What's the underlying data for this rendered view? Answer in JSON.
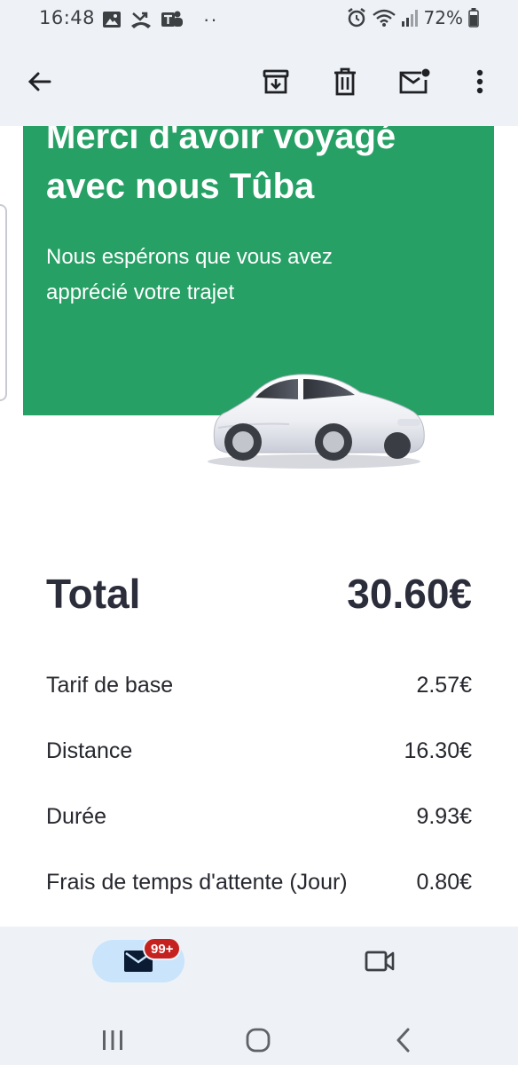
{
  "status_bar": {
    "time": "16:48",
    "dots": "··",
    "battery_percent": "72%",
    "icons": [
      "gallery-icon",
      "missed-call-icon",
      "teams-icon",
      "alarm-icon",
      "wifi-icon",
      "signal-icon",
      "battery-icon"
    ]
  },
  "toolbar": {
    "icons": [
      "back-arrow-icon",
      "archive-icon",
      "delete-icon",
      "mark-unread-icon",
      "more-vert-icon"
    ]
  },
  "email": {
    "hero_title_line1": "Merci d'avoir voyagé",
    "hero_title_line2": "avec nous Tûba",
    "hero_subtitle_line1": "Nous espérons que vous avez",
    "hero_subtitle_line2": "apprécié votre trajet",
    "hero_color": "#26a065",
    "total_label": "Total",
    "total_value": "30.60€",
    "items": [
      {
        "label": "Tarif de base",
        "value": "2.57€"
      },
      {
        "label": "Distance",
        "value": "16.30€"
      },
      {
        "label": "Durée",
        "value": "9.93€"
      },
      {
        "label": "Frais de temps d'attente (Jour)",
        "value": "0.80€"
      }
    ]
  },
  "bottom_nav": {
    "mail_badge": "99+",
    "icons": [
      "mail-icon",
      "video-camera-icon"
    ]
  },
  "system_nav": {
    "icons": [
      "recent-apps-icon",
      "home-icon",
      "back-icon"
    ]
  }
}
